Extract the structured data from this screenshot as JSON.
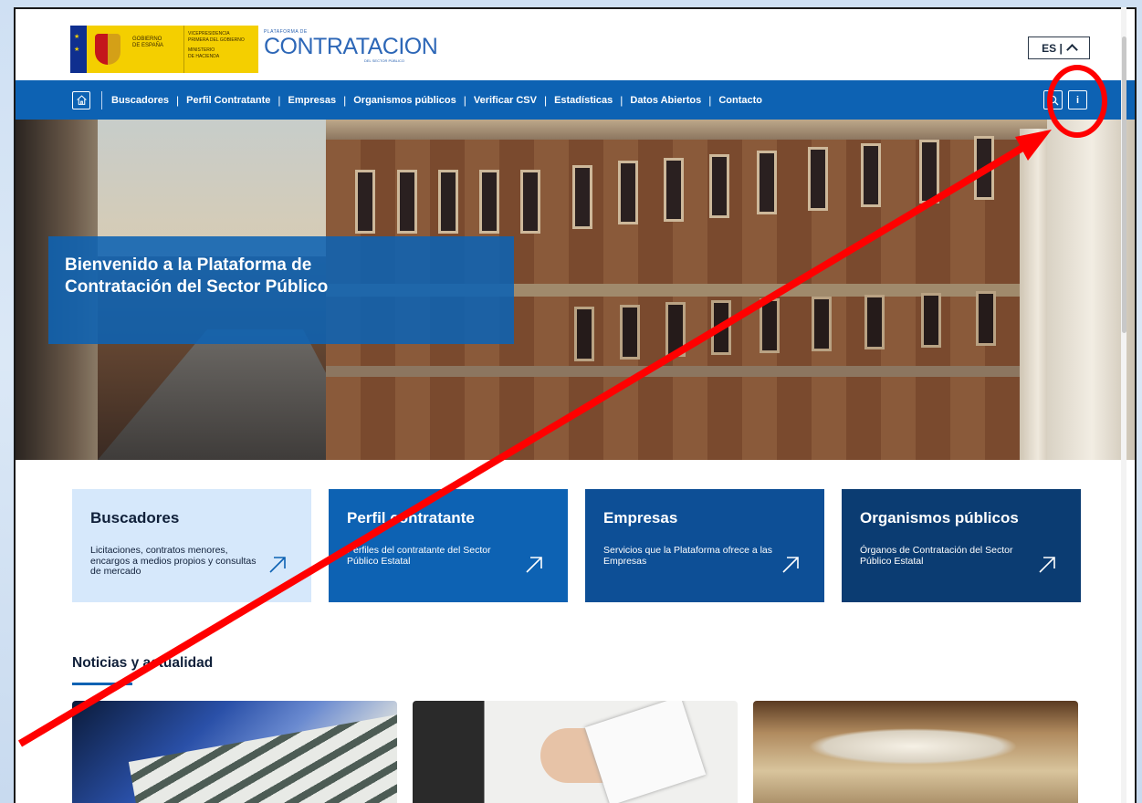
{
  "header": {
    "gov_logo": {
      "line1": "GOBIERNO",
      "line2": "DE ESPAÑA",
      "line3": "VICEPRESIDENCIA",
      "line4": "PRIMERA DEL GOBIERNO",
      "line5": "MINISTERIO",
      "line6": "DE HACIENDA"
    },
    "platform_small": "PLATAFORMA DE",
    "platform_title": "CONTRATACION",
    "platform_sub": "DEL SECTOR PÚBLICO",
    "language": "ES |"
  },
  "nav": {
    "items": [
      {
        "label": "Buscadores"
      },
      {
        "label": "Perfil Contratante"
      },
      {
        "label": "Empresas"
      },
      {
        "label": "Organismos públicos"
      },
      {
        "label": "Verificar CSV"
      },
      {
        "label": "Estadísticas"
      },
      {
        "label": "Datos Abiertos"
      },
      {
        "label": "Contacto"
      }
    ],
    "info_label": "i"
  },
  "hero": {
    "title": "Bienvenido a la Plataforma de Contratación del Sector Público"
  },
  "cards": [
    {
      "title": "Buscadores",
      "desc": "Licitaciones, contratos menores, encargos a medios propios y consultas de mercado"
    },
    {
      "title": "Perfil contratante",
      "desc": "Perfiles del contratante del Sector Público Estatal"
    },
    {
      "title": "Empresas",
      "desc": "Servicios que la Plataforma ofrece a las Empresas"
    },
    {
      "title": "Organismos públicos",
      "desc": "Órganos de Contratación del Sector Público Estatal"
    }
  ],
  "news": {
    "title": "Noticias y actualidad"
  },
  "colors": {
    "primary": "#0d62b3",
    "card_light": "#d6e8fb",
    "card_dark": "#0b3c72",
    "annotation": "#ff0000"
  }
}
